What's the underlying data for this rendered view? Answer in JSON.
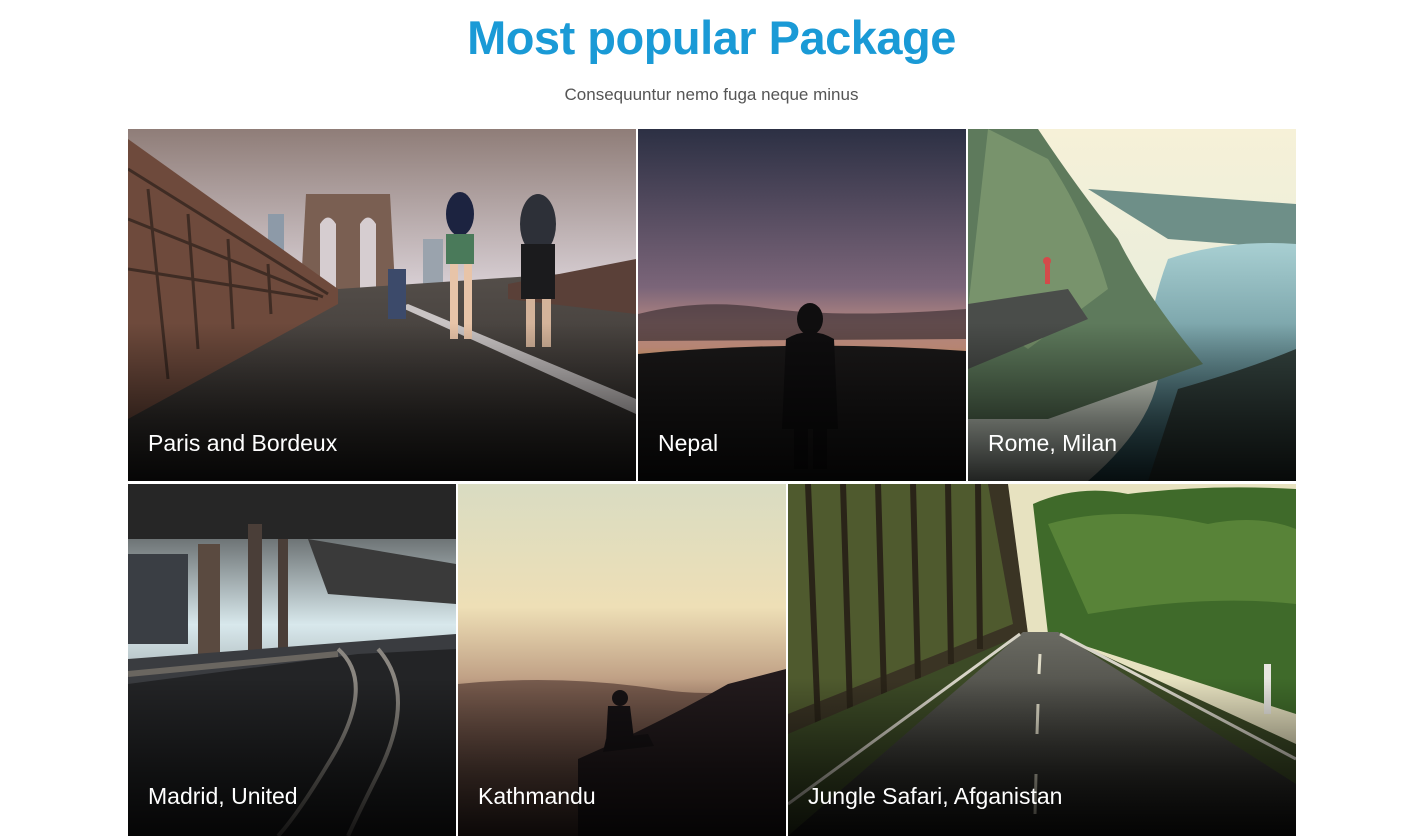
{
  "section": {
    "title": "Most popular Package",
    "subtitle": "Consequuntur nemo fuga neque minus"
  },
  "packages": [
    {
      "label": "Paris and Bordeux",
      "photo": "bridge-runners"
    },
    {
      "label": "Nepal",
      "photo": "sunset-silhouette"
    },
    {
      "label": "Rome, Milan",
      "photo": "fjord-cliff"
    },
    {
      "label": "Madrid, United",
      "photo": "railway-station"
    },
    {
      "label": "Kathmandu",
      "photo": "misty-hill-sitter"
    },
    {
      "label": "Jungle Safari, Afganistan",
      "photo": "forest-road"
    }
  ],
  "colors": {
    "title": "#1a9ad6",
    "subtitle": "#555555"
  }
}
